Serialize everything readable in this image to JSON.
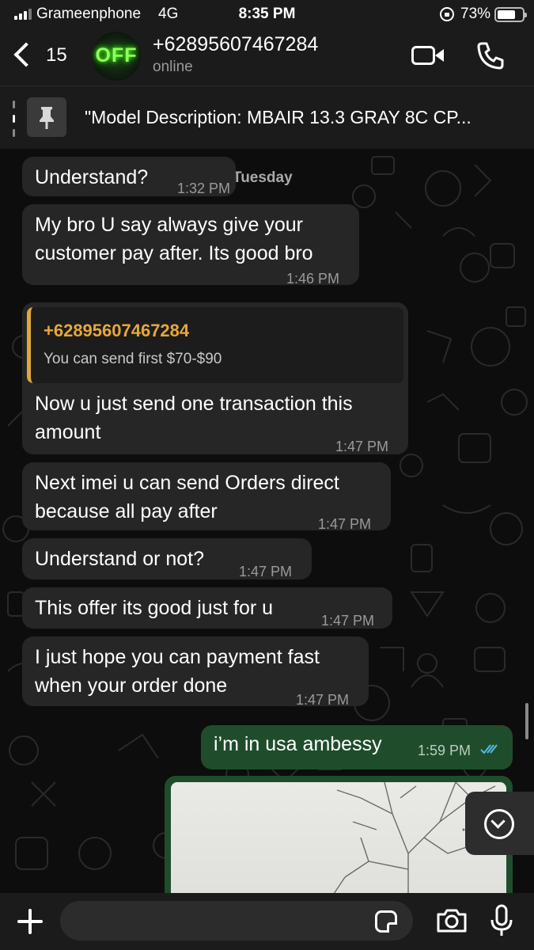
{
  "status_bar": {
    "carrier": "Grameenphone",
    "network": "4G",
    "time": "8:35 PM",
    "battery_percent": "73%",
    "battery_level": 0.73
  },
  "header": {
    "back_count": "15",
    "avatar_text": "OFF",
    "contact_name": "+62895607467284",
    "contact_status": "online"
  },
  "pinned": {
    "text": "\"Model Description: MBAIR 13.3 GRAY 8C CP..."
  },
  "chat": {
    "day_label": "Tuesday",
    "messages": [
      {
        "text": "Understand?",
        "time": "1:32 PM"
      },
      {
        "text_line1": "My bro U say always give your",
        "text_line2": "customer pay after. Its good bro",
        "time": "1:46 PM"
      },
      {
        "quote_name": "+62895607467284",
        "quote_text": "You can send first $70-$90",
        "text_line1": "Now u just send one transaction this",
        "text_line2": "amount",
        "time": "1:47 PM"
      },
      {
        "text_line1": "Next imei u can send Orders direct",
        "text_line2": "because all pay after",
        "time": "1:47 PM"
      },
      {
        "text": "Understand or not?",
        "time": "1:47 PM"
      },
      {
        "text": "This offer its good just for u",
        "time": "1:47 PM"
      },
      {
        "text_line1": "I just hope you can payment fast",
        "text_line2": "when your order done",
        "time": "1:47 PM"
      }
    ],
    "outgoing": {
      "text": "i’m in usa ambessy",
      "time": "1:59 PM",
      "status": "read"
    }
  },
  "composer": {
    "placeholder": ""
  },
  "colors": {
    "incoming_bubble": "#262626",
    "outgoing_bubble": "#1f4d2c",
    "quote_accent": "#e2a83a",
    "read_ticks": "#53bdeb"
  }
}
